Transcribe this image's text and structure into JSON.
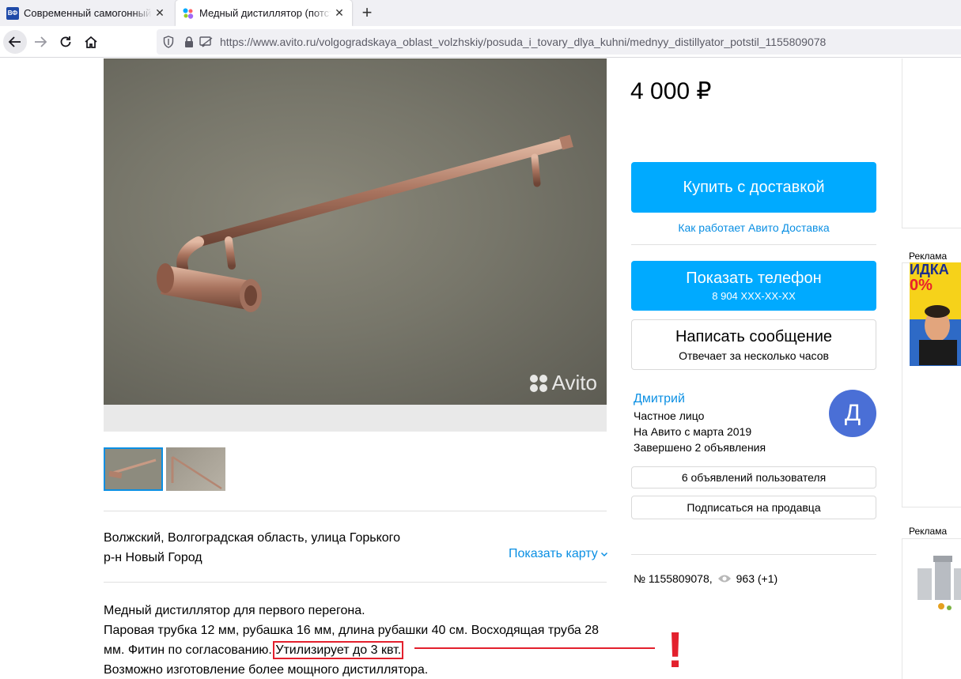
{
  "browser": {
    "tabs": [
      {
        "title": "Современный самогонный аппарат",
        "favicon": "ВФ",
        "active": false
      },
      {
        "title": "Медный дистиллятор (потстил) купить",
        "active": true
      }
    ],
    "url": "https://www.avito.ru/volgogradskaya_oblast_volzhskiy/posuda_i_tovary_dlya_kuhni/mednyy_distillyator_potstil_1155809078"
  },
  "listing": {
    "price": "4 000 ₽",
    "watermark": "Avito",
    "buy_button": "Купить с доставкой",
    "delivery_link": "Как работает Авито Доставка",
    "phone_button": "Показать телефон",
    "phone_masked": "8 904 XXX-XX-XX",
    "message_button": "Написать сообщение",
    "message_sub": "Отвечает за несколько часов",
    "seller": {
      "name": "Дмитрий",
      "type": "Частное лицо",
      "since": "На Авито с марта 2019",
      "completed": "Завершено 2 объявления",
      "avatar_letter": "Д"
    },
    "user_ads_button": "6 объявлений пользователя",
    "subscribe_button": "Подписаться на продавца",
    "address_line1": "Волжский, Волгоградская область, улица Горького",
    "address_line2": "р-н Новый Город",
    "show_map": "Показать карту",
    "ad_number": "№ 1155809078,",
    "views": "963 (+1)",
    "description": {
      "line1": "Медный дистиллятор для первого перегона.",
      "line2a": "Паровая трубка 12 мм, рубашка 16 мм, длина рубашки 40 см. Восходящая труба 28",
      "line2b": "мм. Фитин по согласованию.",
      "highlight": "Утилизирует до 3 квт.",
      "line3": "Возможно изготовление более мощного дистиллятора."
    },
    "annotation_mark": "!"
  },
  "ads": {
    "label1": "Реклама",
    "label2": "Реклама",
    "ad1_text_top": "ИДКА",
    "ad1_text_bottom": "0%"
  },
  "colors": {
    "accent": "#00aaff",
    "link": "#0a8fe3",
    "avatar": "#4a6fd6",
    "annotation": "#e3202d"
  }
}
